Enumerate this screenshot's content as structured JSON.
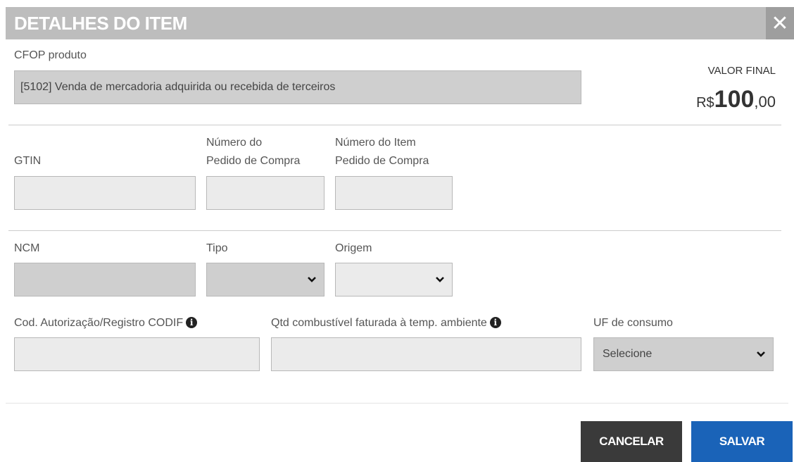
{
  "modal": {
    "title": "DETALHES DO ITEM",
    "close_label": "✕"
  },
  "cfop": {
    "label": "CFOP produto",
    "value": "[5102] Venda de mercadoria adquirida ou recebida de terceiros"
  },
  "valor_final": {
    "label": "VALOR FINAL",
    "currency": "R$",
    "integer": "100",
    "decimals": ",00"
  },
  "fields": {
    "gtin": {
      "label": "GTIN",
      "value": ""
    },
    "numero_pedido": {
      "label_line1": "Número do",
      "label_line2": "Pedido de Compra",
      "value": ""
    },
    "numero_item": {
      "label_line1": "Número do Item",
      "label_line2": "Pedido de Compra",
      "value": ""
    },
    "ncm": {
      "label": "NCM",
      "value": ""
    },
    "tipo": {
      "label": "Tipo",
      "value": ""
    },
    "origem": {
      "label": "Origem",
      "value": ""
    },
    "codif": {
      "label": "Cod. Autorização/Registro CODIF",
      "value": ""
    },
    "qtd_combustivel": {
      "label": "Qtd combustível faturada à temp. ambiente",
      "value": ""
    },
    "uf_consumo": {
      "label": "UF de consumo",
      "value": "Selecione"
    }
  },
  "buttons": {
    "cancel": "CANCELAR",
    "save": "SALVAR"
  },
  "icons": {
    "info": "info-circle-icon",
    "close": "close-icon",
    "chevron": "chevron-down-icon"
  }
}
